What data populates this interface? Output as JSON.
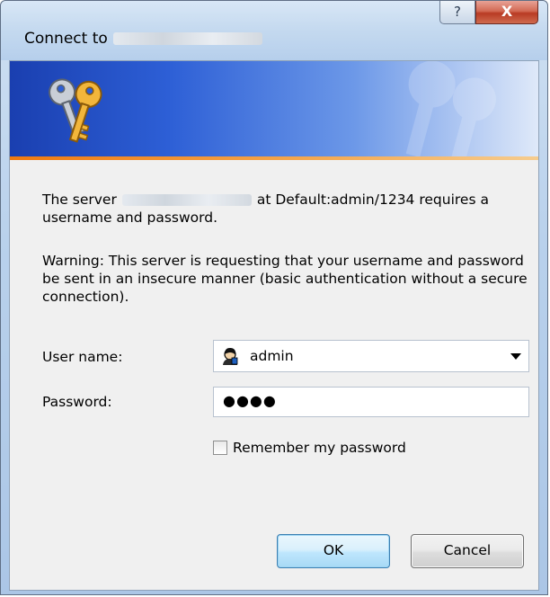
{
  "window": {
    "title": "Connect to",
    "help_label": "?",
    "close_label": "X"
  },
  "message": {
    "line1_prefix": "The server",
    "line1_suffix": "at Default:admin/1234 requires a username and password.",
    "warning": "Warning: This server is requesting that your username and password be sent in an insecure manner (basic authentication without a secure connection)."
  },
  "form": {
    "username_label": "User name:",
    "username_value": "admin",
    "password_label": "Password:",
    "password_value": "●●●●",
    "remember_label": "Remember my password",
    "remember_checked": false
  },
  "buttons": {
    "ok": "OK",
    "cancel": "Cancel"
  },
  "colors": {
    "banner_start": "#1a3fb0",
    "banner_end": "#dfe9f9",
    "accent_line": "#f07a10",
    "close_button": "#c1452d"
  }
}
